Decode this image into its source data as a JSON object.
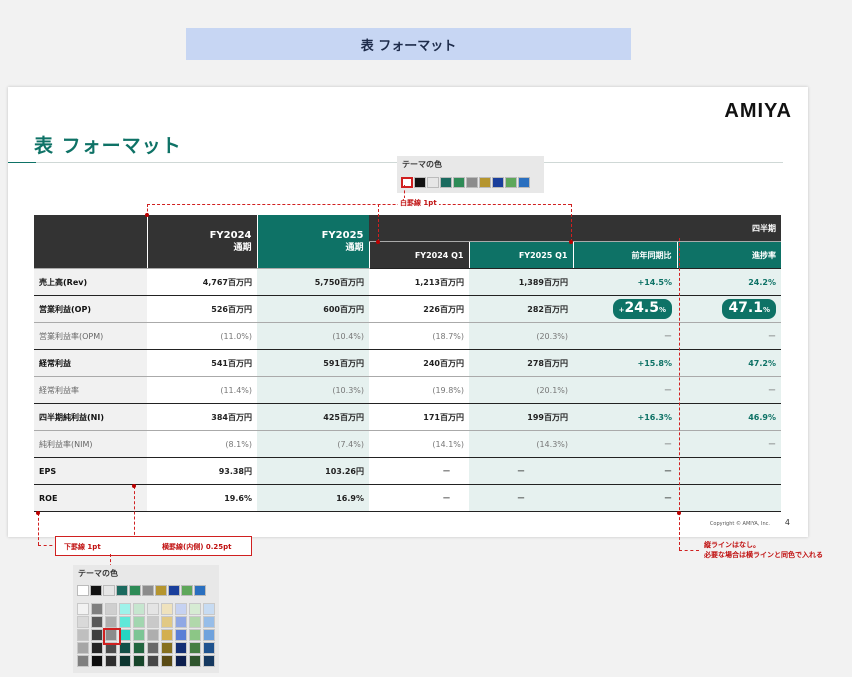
{
  "banner": {
    "title": "表 フォーマット"
  },
  "slide": {
    "logo": "AMIYA",
    "title": "表 フォーマット",
    "copyright": "Copyright © AMIYA, Inc.",
    "page_number": "4"
  },
  "palette_top": {
    "label": "テーマの色",
    "colors": [
      "#ffffff",
      "#111111",
      "#e6e6e6",
      "#1b6a5f",
      "#2e8b57",
      "#8c8c8c",
      "#b5952f",
      "#1a3f9c",
      "#5ea75a",
      "#2a6fbf"
    ]
  },
  "palette_bottom": {
    "label": "テーマの色",
    "colors": [
      "#ffffff",
      "#111111",
      "#e6e6e6",
      "#1b6a5f",
      "#2e8b57",
      "#8c8c8c",
      "#b5952f",
      "#1a3f9c",
      "#5ea75a",
      "#2a6fbf"
    ],
    "shades": [
      [
        "#f2f2f2",
        "#7f7f7f",
        "#cfcfcf",
        "#9ff2ea",
        "#c6e6cf",
        "#e4e4e4",
        "#efe2bd",
        "#c6d2f1",
        "#d6ebd3",
        "#c7dbf2"
      ],
      [
        "#d9d9d9",
        "#595959",
        "#aeaeae",
        "#5fe8d8",
        "#a2d6b0",
        "#c9c9c9",
        "#e1c985",
        "#90a8e4",
        "#b1d8ab",
        "#97bde8"
      ],
      [
        "#bfbfbf",
        "#3f3f3f",
        "#8c8c8c",
        "#25d6c1",
        "#7cc595",
        "#aeaeae",
        "#d3af4f",
        "#5a7fd6",
        "#8cc686",
        "#6fa2dd"
      ],
      [
        "#a6a6a6",
        "#262626",
        "#4d4d4d",
        "#135048",
        "#226640",
        "#6a6a6a",
        "#86701f",
        "#132f75",
        "#457e42",
        "#1f538f"
      ],
      [
        "#7f7f7f",
        "#0d0d0d",
        "#2e2e2e",
        "#0d3530",
        "#17452b",
        "#474747",
        "#5a4b15",
        "#0d1f4e",
        "#2e542c",
        "#15385f"
      ]
    ]
  },
  "annotations": {
    "white_rule": "白罫線 1pt",
    "bottom_rule": "下罫線 1pt",
    "inner_rule": "横罫線(内側) 0.25pt",
    "vertical_note_1": "縦ラインはなし。",
    "vertical_note_2": "必要な場合は横ラインと同色で入れる"
  },
  "table": {
    "header": {
      "fy2024": "FY2024",
      "fy2024_sub": "通期",
      "fy2025": "FY2025",
      "fy2025_sub": "通期",
      "quarter": "四半期",
      "q_fy2024": "FY2024 Q1",
      "q_fy2025": "FY2025 Q1",
      "yoy": "前年同期比",
      "progress": "進捗率"
    },
    "rows": [
      {
        "label": "売上高(Rev)",
        "fy2024": "4,767百万円",
        "fy2025": "5,750百万円",
        "q2024": "1,213百万円",
        "q2025": "1,389百万円",
        "yoy": "+14.5%",
        "progress": "24.2%"
      },
      {
        "label": "営業利益(OP)",
        "fy2024": "526百万円",
        "fy2025": "600百万円",
        "q2024": "226百万円",
        "q2025": "282百万円",
        "yoy_sign": "+",
        "yoy_value": "24.5",
        "yoy_unit": "%",
        "progress_value": "47.1",
        "progress_unit": "%"
      },
      {
        "label": "営業利益率(OPM)",
        "fy2024": "(11.0%)",
        "fy2025": "(10.4%)",
        "q2024": "(18.7%)",
        "q2025": "(20.3%)",
        "yoy": "ー",
        "progress": "ー"
      },
      {
        "label": "経常利益",
        "fy2024": "541百万円",
        "fy2025": "591百万円",
        "q2024": "240百万円",
        "q2025": "278百万円",
        "yoy": "+15.8%",
        "progress": "47.2%"
      },
      {
        "label": "経常利益率",
        "fy2024": "(11.4%)",
        "fy2025": "(10.3%)",
        "q2024": "(19.8%)",
        "q2025": "(20.1%)",
        "yoy": "ー",
        "progress": "ー"
      },
      {
        "label": "四半期純利益(NI)",
        "fy2024": "384百万円",
        "fy2025": "425百万円",
        "q2024": "171百万円",
        "q2025": "199百万円",
        "yoy": "+16.3%",
        "progress": "46.9%"
      },
      {
        "label": "純利益率(NIM)",
        "fy2024": "(8.1%)",
        "fy2025": "(7.4%)",
        "q2024": "(14.1%)",
        "q2025": "(14.3%)",
        "yoy": "ー",
        "progress": "ー"
      },
      {
        "label": "EPS",
        "fy2024": "93.38円",
        "fy2025": "103.26円",
        "q2024": "ー",
        "q2025": "ー",
        "yoy": "ー",
        "progress": ""
      },
      {
        "label": "ROE",
        "fy2024": "19.6%",
        "fy2025": "16.9%",
        "q2024": "ー",
        "q2025": "ー",
        "yoy": "ー",
        "progress": ""
      }
    ]
  }
}
